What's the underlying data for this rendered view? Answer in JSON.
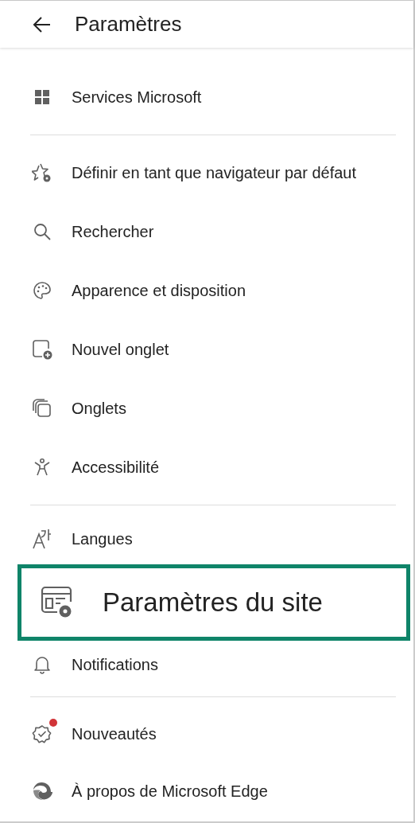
{
  "header": {
    "title": "Paramètres"
  },
  "sections": [
    {
      "items": [
        {
          "label": "Services Microsoft",
          "highlighted": false,
          "notification_dot": false
        }
      ]
    },
    {
      "items": [
        {
          "label": "Définir en tant que navigateur par défaut",
          "highlighted": false,
          "notification_dot": false
        },
        {
          "label": "Rechercher",
          "highlighted": false,
          "notification_dot": false
        },
        {
          "label": "Apparence et disposition",
          "highlighted": false,
          "notification_dot": false
        },
        {
          "label": "Nouvel onglet",
          "highlighted": false,
          "notification_dot": false
        },
        {
          "label": "Onglets",
          "highlighted": false,
          "notification_dot": false
        },
        {
          "label": "Accessibilité",
          "highlighted": false,
          "notification_dot": false
        }
      ]
    },
    {
      "items": [
        {
          "label": "Langues",
          "highlighted": false,
          "notification_dot": false
        },
        {
          "label": "Paramètres du site",
          "highlighted": true,
          "notification_dot": false
        },
        {
          "label": "Notifications",
          "highlighted": false,
          "notification_dot": false
        }
      ]
    },
    {
      "items": [
        {
          "label": "Nouveautés",
          "highlighted": false,
          "notification_dot": true
        },
        {
          "label": "À propos de Microsoft Edge",
          "highlighted": false,
          "notification_dot": false
        }
      ]
    }
  ]
}
